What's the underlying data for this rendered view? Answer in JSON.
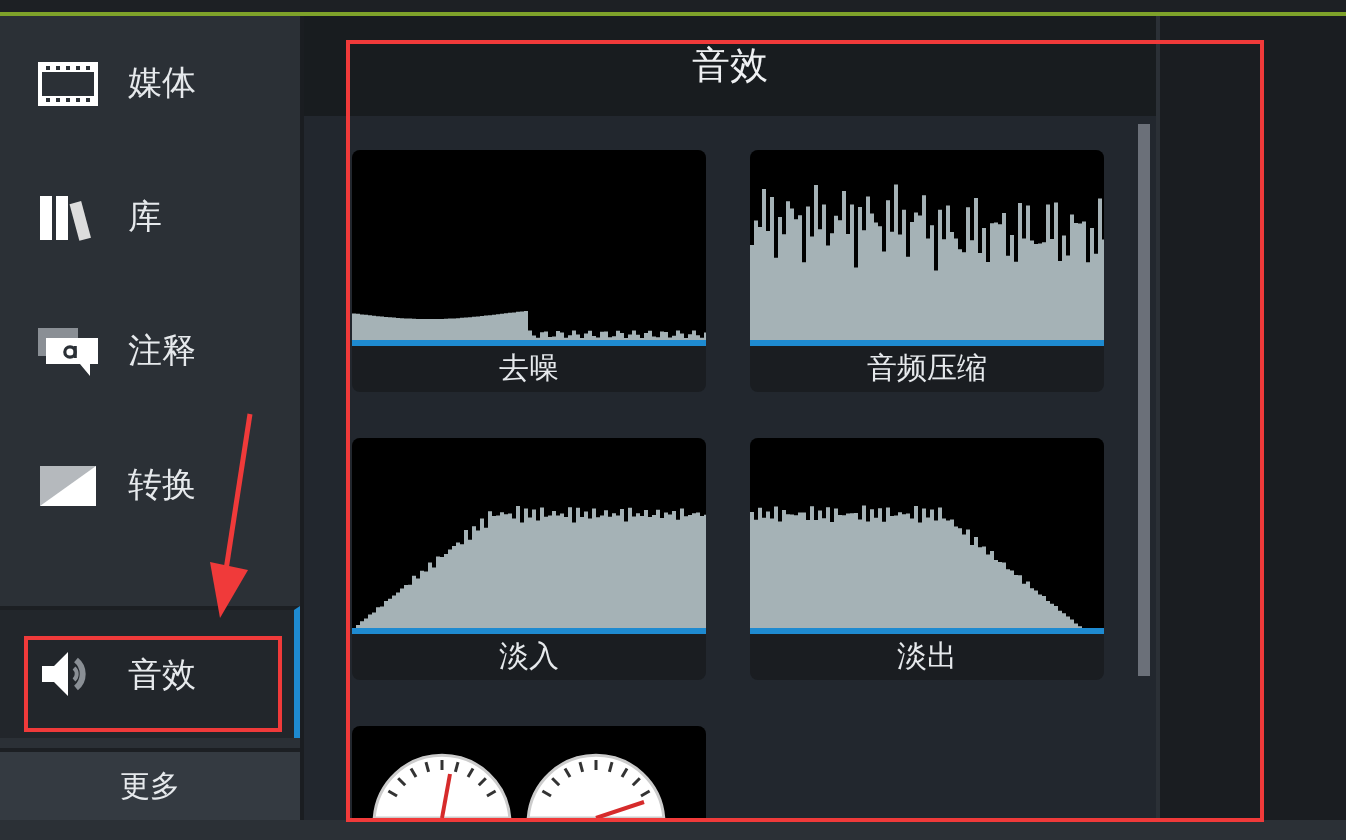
{
  "sidebar": {
    "items": [
      {
        "label": "媒体",
        "kind": "media",
        "selected": false
      },
      {
        "label": "库",
        "kind": "library",
        "selected": false
      },
      {
        "label": "注释",
        "kind": "annotation",
        "selected": false
      },
      {
        "label": "转换",
        "kind": "transition",
        "selected": false
      },
      {
        "label": "音效",
        "kind": "audio",
        "selected": true
      }
    ],
    "more": "更多"
  },
  "panel": {
    "title": "音效",
    "effects": [
      {
        "label": "去噪",
        "kind": "denoise"
      },
      {
        "label": "音频压缩",
        "kind": "compress"
      },
      {
        "label": "淡入",
        "kind": "fadein"
      },
      {
        "label": "淡出",
        "kind": "fadeout"
      },
      {
        "kind": "meters"
      }
    ]
  }
}
